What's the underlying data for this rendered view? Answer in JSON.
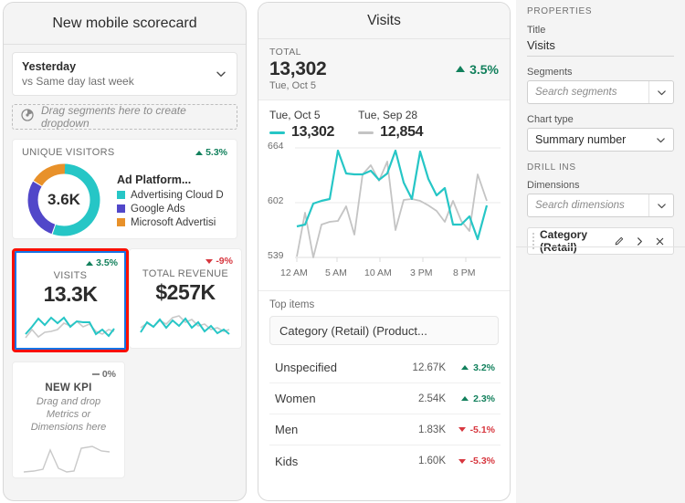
{
  "scorecard": {
    "title": "New mobile scorecard",
    "date_selector": {
      "primary": "Yesterday",
      "secondary": "vs Same day last week",
      "chevron_icon": "chevron-down-icon"
    },
    "drag_segments": {
      "icon": "segment-icon",
      "placeholder": "Drag segments here to create dropdown"
    },
    "unique_visitors": {
      "label": "UNIQUE VISITORS",
      "delta": "5.3%",
      "delta_direction": "up",
      "center_value": "3.6K",
      "legend_title": "Ad Platform...",
      "legend": [
        {
          "label": "Advertising Cloud D",
          "color": "#26c6c6"
        },
        {
          "label": "Google Ads",
          "color": "#5147c9"
        },
        {
          "label": "Microsoft Advertisi",
          "color": "#e8912a"
        }
      ],
      "donut_segments": [
        {
          "name": "Advertising Cloud D",
          "percent": 55,
          "color": "#26c6c6"
        },
        {
          "name": "Google Ads",
          "percent": 28,
          "color": "#5147c9"
        },
        {
          "name": "Microsoft Advertisi",
          "percent": 17,
          "color": "#e8912a"
        }
      ]
    },
    "kpi_tiles": [
      {
        "name": "VISITS",
        "value": "13.3K",
        "delta": "3.5%",
        "delta_direction": "up",
        "selected": true
      },
      {
        "name": "TOTAL REVENUE",
        "value": "$257K",
        "delta": "-9%",
        "delta_direction": "down",
        "selected": false
      }
    ],
    "new_kpi": {
      "delta": "0%",
      "delta_direction": "flat",
      "name": "NEW KPI",
      "hint": "Drag and drop Metrics or Dimensions here"
    }
  },
  "visits_panel": {
    "title": "Visits",
    "total": {
      "label": "TOTAL",
      "value": "13,302",
      "date": "Tue, Oct 5",
      "delta": "3.5%",
      "delta_direction": "up"
    },
    "series": [
      {
        "date": "Tue, Oct 5",
        "value": "13,302",
        "color": "#26c6c6"
      },
      {
        "date": "Tue, Sep 28",
        "value": "12,854",
        "color": "#c4c4c4"
      }
    ],
    "top_items": {
      "label": "Top items",
      "dimension": "Category (Retail) (Product...",
      "rows": [
        {
          "name": "Unspecified",
          "value": "12.67K",
          "delta": "3.2%",
          "delta_direction": "up"
        },
        {
          "name": "Women",
          "value": "2.54K",
          "delta": "2.3%",
          "delta_direction": "up"
        },
        {
          "name": "Men",
          "value": "1.83K",
          "delta": "-5.1%",
          "delta_direction": "down"
        },
        {
          "name": "Kids",
          "value": "1.60K",
          "delta": "-5.3%",
          "delta_direction": "down"
        }
      ]
    }
  },
  "properties": {
    "heading": "PROPERTIES",
    "title_label": "Title",
    "title_value": "Visits",
    "segments_label": "Segments",
    "segments_placeholder": "Search segments",
    "chart_type_label": "Chart type",
    "chart_type_value": "Summary number",
    "drill_ins_heading": "DRILL INS",
    "dimensions_label": "Dimensions",
    "dimensions_placeholder": "Search dimensions",
    "dimension_chip": {
      "label": "Category (Retail)",
      "edit_icon": "pencil-icon",
      "expand_icon": "chevron-right-icon",
      "remove_icon": "close-icon"
    }
  },
  "chart_data": {
    "type": "line",
    "title": "Visits",
    "xlabel": "",
    "ylabel": "",
    "ylim": [
      539,
      664
    ],
    "yticks": [
      539,
      602,
      664
    ],
    "xticks": [
      "12 AM",
      "5 AM",
      "10 AM",
      "3 PM",
      "8 PM"
    ],
    "grid": true,
    "legend_position": "top",
    "x": [
      0,
      1,
      2,
      3,
      4,
      5,
      6,
      7,
      8,
      9,
      10,
      11,
      12,
      13,
      14,
      15,
      16,
      17,
      18,
      19,
      20,
      21,
      22,
      23
    ],
    "series": [
      {
        "name": "Tue, Oct 5",
        "color": "#26c6c6",
        "values": [
          575,
          577,
          601,
          604,
          606,
          661,
          635,
          634,
          634,
          638,
          629,
          636,
          661,
          624,
          603,
          658,
          627,
          608,
          617,
          577,
          577,
          586,
          560,
          597
        ]
      },
      {
        "name": "Tue, Sep 28",
        "color": "#c4c4c4",
        "values": [
          541,
          592,
          540,
          575,
          578,
          579,
          595,
          561,
          630,
          641,
          623,
          645,
          570,
          601,
          602,
          600,
          595,
          589,
          577,
          592,
          569,
          557,
          622,
          595
        ]
      }
    ]
  }
}
